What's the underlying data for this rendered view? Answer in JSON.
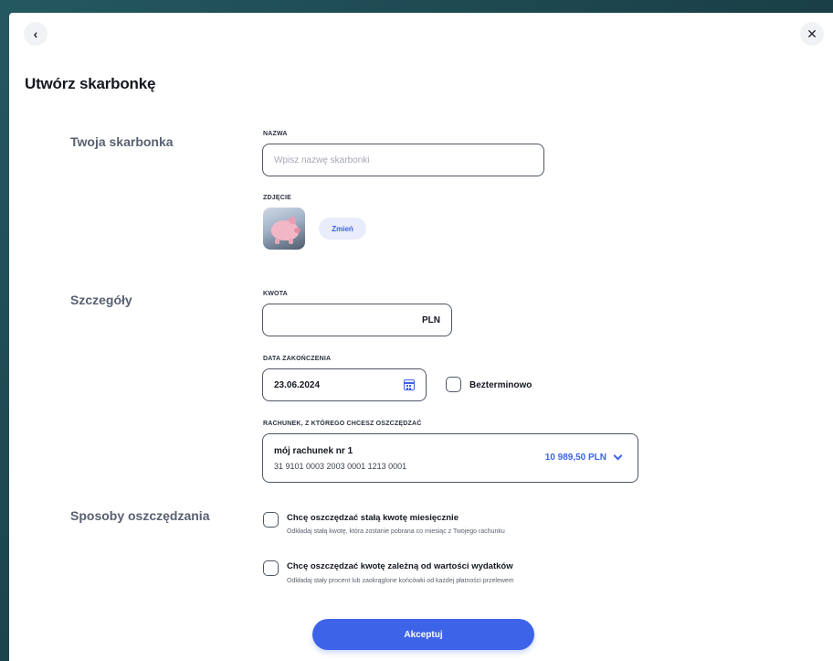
{
  "header": {
    "back_icon": "chevron-left-icon",
    "close_icon": "close-icon",
    "title": "Utwórz skarbonkę"
  },
  "sections": {
    "piggy": "Twoja skarbonka",
    "details": "Szczegóły",
    "methods": "Sposoby oszczędzania"
  },
  "name_field": {
    "label": "NAZWA",
    "placeholder": "Wpisz nazwę skarbonki"
  },
  "photo": {
    "label": "ZDJĘCIE",
    "change_label": "Zmień"
  },
  "amount_field": {
    "label": "KWOTA",
    "value": "",
    "currency": "PLN"
  },
  "end_date": {
    "label": "DATA ZAKOŃCZENIA",
    "value": "23.06.2024",
    "icon": "calendar-icon",
    "indefinite_label": "Bezterminowo",
    "indefinite_checked": false
  },
  "account": {
    "label": "RACHUNEK, Z KTÓREGO CHCESZ OSZCZĘDZAĆ",
    "name": "mój rachunek nr 1",
    "number": "31 9101 0003 2003 0001 1213 0001",
    "balance": "10 989,50 PLN"
  },
  "options": [
    {
      "title": "Chcę oszczędzać stałą kwotę miesięcznie",
      "desc": "Odkładaj stałą kwotę, która zostanie pobrana co miesiąc z Twojego rachunku",
      "checked": false
    },
    {
      "title": "Chcę oszczędzać kwotę zależną od wartości wydatków",
      "desc": "Odkładaj stały procent lub zaokrąglone końcówki od każdej płatności przelewem",
      "checked": false
    }
  ],
  "accept_label": "Akceptuj",
  "colors": {
    "accent": "#3d63e8",
    "backdrop": "#1d4a52"
  }
}
